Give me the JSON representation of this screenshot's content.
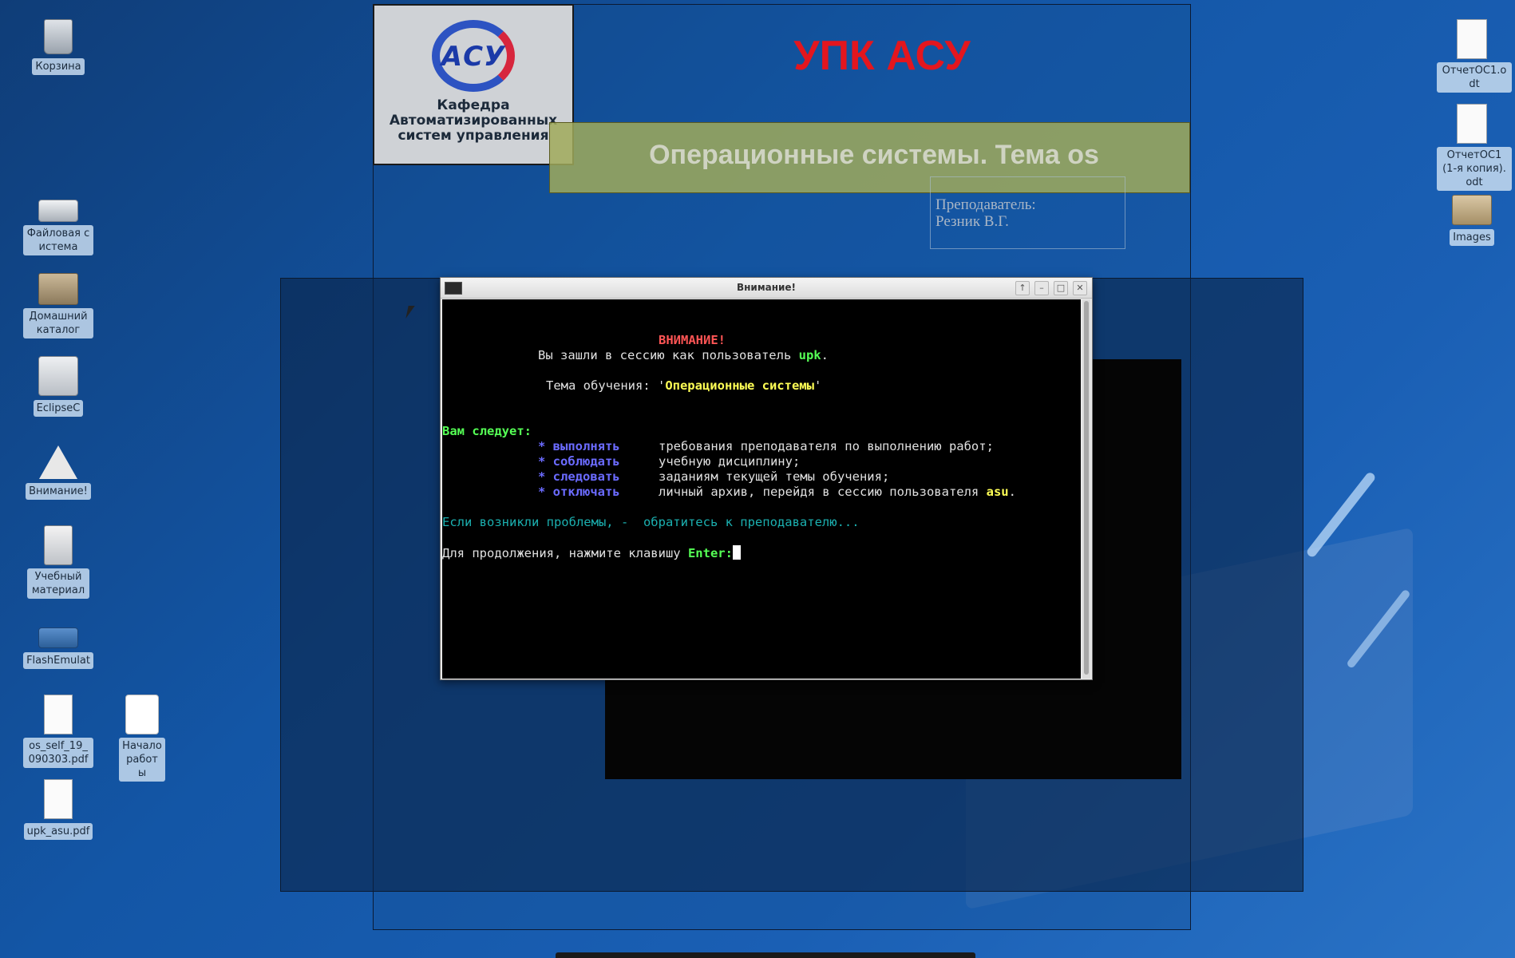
{
  "desktop": {
    "icons_left": [
      {
        "label": "Корзина",
        "icon": "trash-icon"
      },
      {
        "label": "Файловая система",
        "icon": "drive-icon"
      },
      {
        "label": "Домашний каталог",
        "icon": "home-folder-icon"
      },
      {
        "label": "EclipseC",
        "icon": "eclipse-icon"
      },
      {
        "label": "Внимание!",
        "icon": "warning-icon"
      },
      {
        "label": "Учебный материал",
        "icon": "cabinet-icon"
      },
      {
        "label": "FlashEmulat",
        "icon": "flash-drive-icon"
      },
      {
        "label": "os_self_19_090303.pdf",
        "icon": "pdf-document-icon"
      },
      {
        "label": "Начало работы",
        "icon": "pdf-start-icon"
      },
      {
        "label": "upk_asu.pdf",
        "icon": "pdf-document-icon"
      }
    ],
    "icons_right": [
      {
        "label": "ОтчетОС1.odt",
        "icon": "odt-document-icon"
      },
      {
        "label": "ОтчетОС1 (1-я копия).odt",
        "icon": "odt-document-icon"
      },
      {
        "label": "Images",
        "icon": "folder-icon"
      }
    ]
  },
  "presentation": {
    "logo_mark": "АСУ",
    "logo_caption": "Кафедра Автоматизированных систем управления",
    "title": "УПК АСУ",
    "subtitle": "Операционные системы. Тема os",
    "teacher_label": "Преподаватель:",
    "teacher_name": "Резник В.Г."
  },
  "terminal": {
    "title": "Внимание!",
    "buttons": [
      "↑",
      "–",
      "□",
      "✕"
    ],
    "lines": {
      "warning": "ВНИМАНИЕ!",
      "session_prefix": "Вы зашли в сессию как пользователь ",
      "session_user": "upk",
      "session_suffix": ".",
      "topic_prefix": "Тема обучения: '",
      "topic_name": "Операционные системы",
      "topic_suffix": "'",
      "must_heading": "Вам следует:",
      "rules": [
        {
          "bullet": "* выполнять",
          "text": "требования преподавателя по выполнению работ;"
        },
        {
          "bullet": "* соблюдать",
          "text": "учебную дисциплину;"
        },
        {
          "bullet": "* следовать",
          "text": "заданиям текущей темы обучения;"
        },
        {
          "bullet": "* отключать",
          "text": "личный архив, перейдя в сессию пользователя ",
          "user": "asu",
          "end": "."
        }
      ],
      "problems": "Если возникли проблемы, -  обратитесь к преподавателю...",
      "continue_prefix": "Для продолжения, нажмите клавишу ",
      "continue_key": "Enter",
      "continue_suffix": ":"
    }
  },
  "colors": {
    "title_red": "#e3161e",
    "terminal_bg": "#000000",
    "accent_blue": "#1a5fb4"
  }
}
